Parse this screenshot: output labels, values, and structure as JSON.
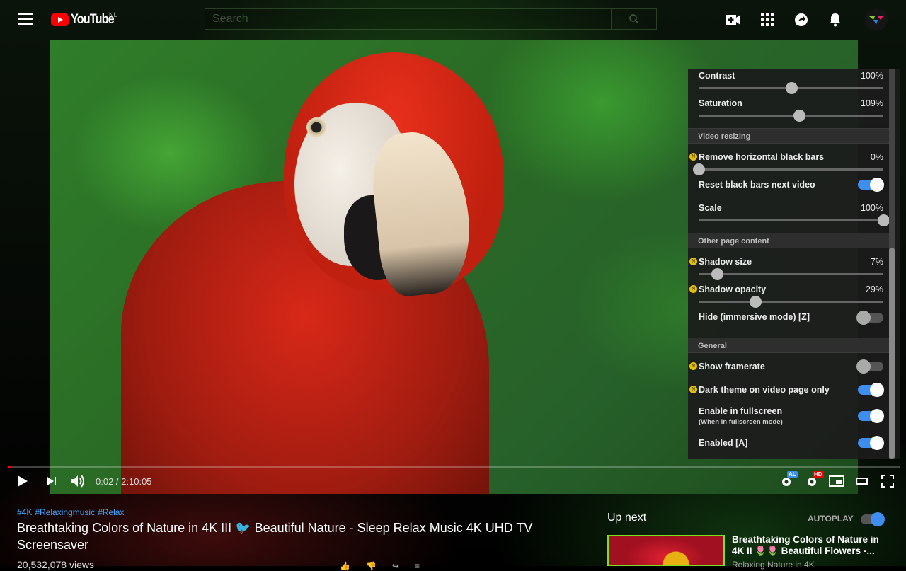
{
  "header": {
    "logo_text": "YouTube",
    "country_code": "NL",
    "search_placeholder": "Search",
    "icons": [
      "menu-icon",
      "create-video-icon",
      "apps-icon",
      "messages-icon",
      "notifications-icon",
      "avatar"
    ]
  },
  "player": {
    "time_current": "0:02",
    "time_separator": " / ",
    "time_total": "2:10:05",
    "progress_fraction": 0.0003,
    "badges": {
      "ambilight": "AL",
      "quality": "HD"
    }
  },
  "panel": {
    "rows": {
      "contrast": {
        "label": "Contrast",
        "value": "100%",
        "fraction": 0.5
      },
      "saturation": {
        "label": "Saturation",
        "value": "109%",
        "fraction": 0.545
      },
      "remove_bars": {
        "label": "Remove horizontal black bars",
        "value": "0%",
        "fraction": 0.0,
        "new": true
      },
      "reset_bars": {
        "label": "Reset black bars next video",
        "on": true
      },
      "scale": {
        "label": "Scale",
        "value": "100%",
        "fraction": 1.0
      },
      "shadow_size": {
        "label": "Shadow size",
        "value": "7%",
        "fraction": 0.1,
        "new": true
      },
      "shadow_opacity": {
        "label": "Shadow opacity",
        "value": "29%",
        "fraction": 0.305,
        "new": true
      },
      "hide_immersive": {
        "label": "Hide (immersive mode) [Z]",
        "on": false
      },
      "show_framerate": {
        "label": "Show framerate",
        "on": false,
        "new": true
      },
      "dark_theme": {
        "label": "Dark theme on video page only",
        "on": true,
        "new": true
      },
      "fullscreen": {
        "label": "Enable in fullscreen",
        "sublabel": "(When in fullscreen mode)",
        "on": true
      },
      "enabled": {
        "label": "Enabled [A]",
        "on": true
      }
    },
    "sections": {
      "video_resizing": "Video resizing",
      "other_page_content": "Other page content",
      "general": "General"
    },
    "new_badge": "N"
  },
  "video": {
    "tags": [
      "#4K",
      "#Relaxingmusic",
      "#Relax"
    ],
    "title": "Breathtaking Colors of Nature in 4K III 🐦 Beautiful Nature - Sleep Relax Music 4K UHD TV Screensaver",
    "views": "20,532,078 views"
  },
  "sidebar": {
    "up_next": "Up next",
    "autoplay_label": "AUTOPLAY",
    "autoplay_on": true,
    "recommendation": {
      "title": "Breathtaking Colors of Nature in 4K II 🌷🌷 Beautiful Flowers -...",
      "channel": "Relaxing Nature in 4K"
    }
  },
  "colors": {
    "accent_blue": "#3e8ef0",
    "youtube_red": "#ff0000",
    "new_badge_yellow": "#e6c000",
    "link_blue": "#3ea6ff"
  }
}
